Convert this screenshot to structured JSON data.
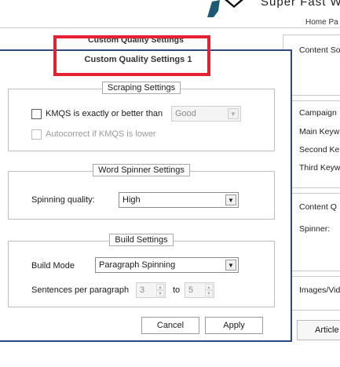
{
  "background": {
    "tagline": "Super Fast W",
    "breadcrumb": "Home Pa",
    "title": "Custom Quality Settings",
    "side_labels": [
      "Content So",
      "Campaign",
      "Main Keyw",
      "Second Ke",
      "Third Keyw",
      "Content Q",
      "Spinner:",
      "Images/Vid"
    ],
    "article_button": "Article"
  },
  "dialog": {
    "title": "Custom Quality Settings 1",
    "scraping": {
      "legend": "Scraping Settings",
      "kmqs_label": "KMQS is exactly or better than",
      "kmqs_checked": false,
      "kmqs_select": "Good",
      "autocorrect_label": "Autocorrect if KMQS is lower",
      "autocorrect_checked": false
    },
    "spinner": {
      "legend": "Word Spinner Settings",
      "quality_label": "Spinning quality:",
      "quality_value": "High"
    },
    "build": {
      "legend": "Build Settings",
      "mode_label": "Build Mode",
      "mode_value": "Paragraph Spinning",
      "sentences_label": "Sentences per paragraph",
      "from_value": "3",
      "to_label": "to",
      "to_value": "5"
    },
    "cancel": "Cancel",
    "apply": "Apply"
  },
  "colors": {
    "highlight": "#e52030",
    "dialog_border": "#2b4a83"
  }
}
